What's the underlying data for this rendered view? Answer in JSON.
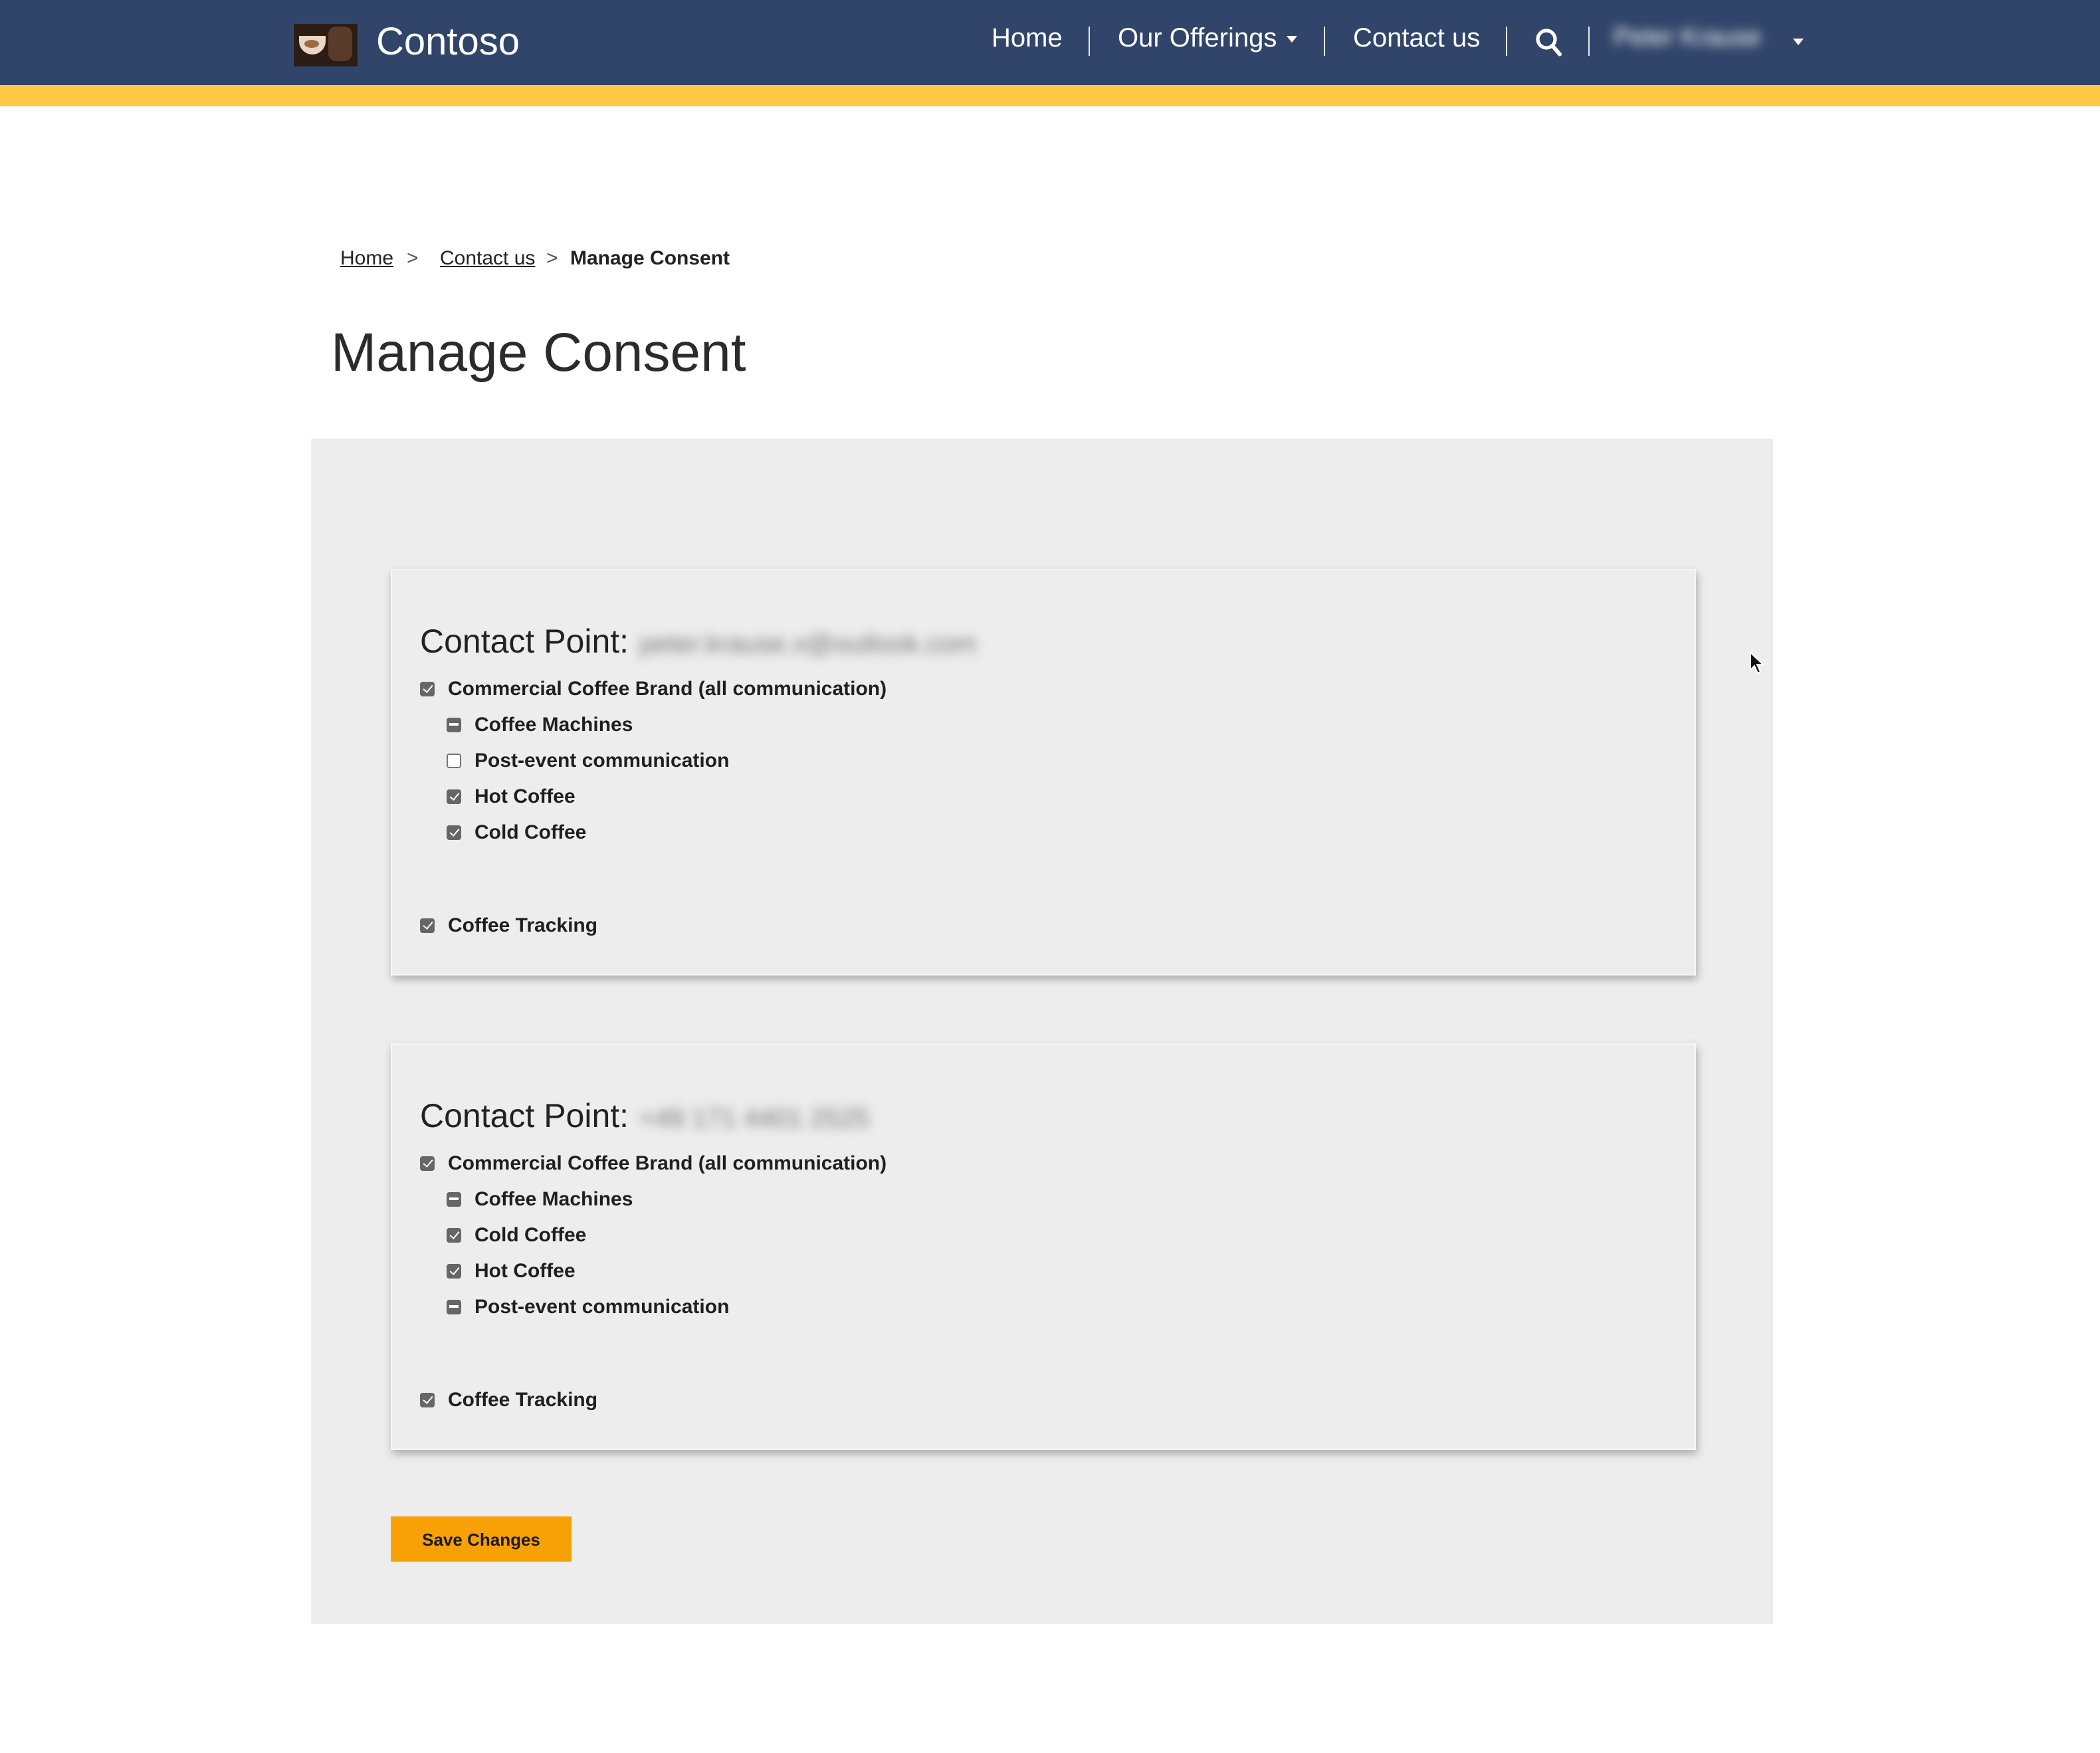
{
  "header": {
    "brand": "Contoso",
    "nav": {
      "home": "Home",
      "offerings": "Our Offerings",
      "contact": "Contact us"
    },
    "user_name": "Peter Krause",
    "colors": {
      "bar": "#31456a",
      "accent": "#ffc845"
    }
  },
  "breadcrumb": {
    "home": "Home",
    "contact": "Contact us",
    "current": "Manage Consent",
    "separator": ">"
  },
  "page_title": "Manage Consent",
  "contact_points": [
    {
      "label": "Contact Point:",
      "value": "peter.krause.x@outlook.com",
      "brand": {
        "label": "Commercial Coffee Brand (all communication)",
        "state": "checked"
      },
      "topics": [
        {
          "label": "Coffee Machines",
          "state": "mixed"
        },
        {
          "label": "Post-event communication",
          "state": "unchecked"
        },
        {
          "label": "Hot Coffee",
          "state": "checked"
        },
        {
          "label": "Cold Coffee",
          "state": "checked"
        }
      ],
      "tracking": {
        "label": "Coffee Tracking",
        "state": "checked"
      }
    },
    {
      "label": "Contact Point:",
      "value": "+49 171 4401 2525",
      "brand": {
        "label": "Commercial Coffee Brand (all communication)",
        "state": "checked"
      },
      "topics": [
        {
          "label": "Coffee Machines",
          "state": "mixed"
        },
        {
          "label": "Cold Coffee",
          "state": "checked"
        },
        {
          "label": "Hot Coffee",
          "state": "checked"
        },
        {
          "label": "Post-event communication",
          "state": "mixed"
        }
      ],
      "tracking": {
        "label": "Coffee Tracking",
        "state": "checked"
      }
    }
  ],
  "save_button": "Save Changes",
  "save_color": "#f8a106"
}
